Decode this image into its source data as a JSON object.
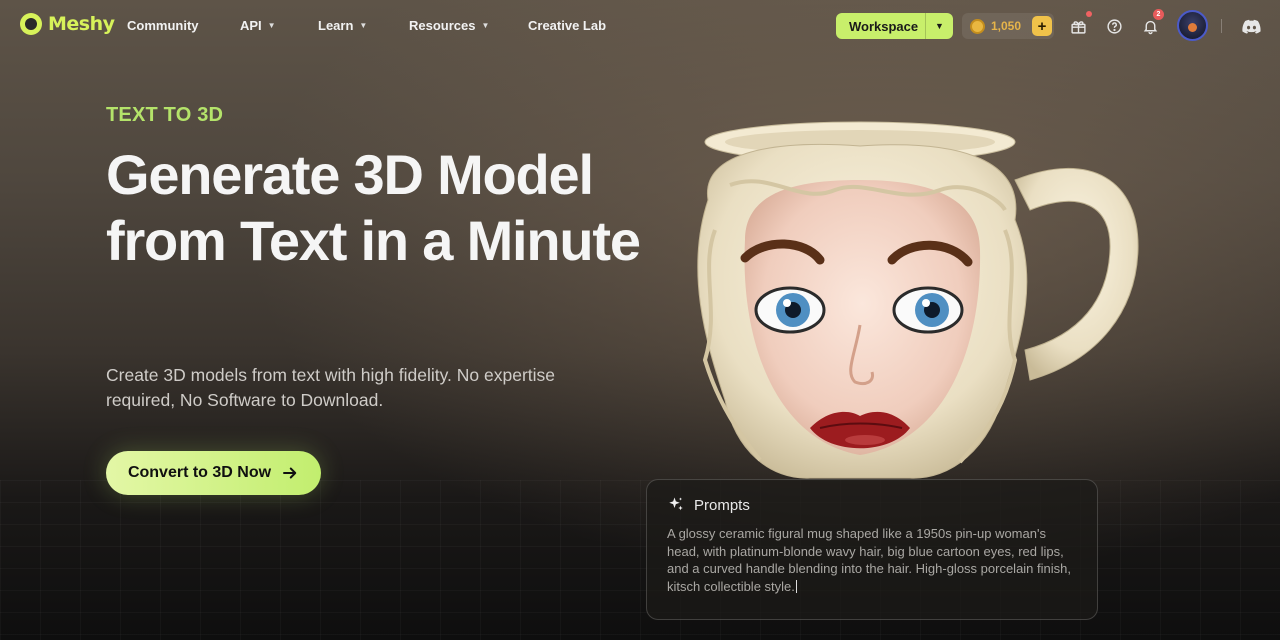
{
  "brand": {
    "name": "Meshy"
  },
  "nav": {
    "links": [
      {
        "label": "Community",
        "has_dropdown": false
      },
      {
        "label": "API",
        "has_dropdown": true
      },
      {
        "label": "Learn",
        "has_dropdown": true
      },
      {
        "label": "Resources",
        "has_dropdown": true
      },
      {
        "label": "Creative Lab",
        "has_dropdown": false
      }
    ],
    "workspace_label": "Workspace",
    "credits": "1,050",
    "notification_count": "2",
    "icons": [
      "gift-icon",
      "help-icon",
      "bell-icon",
      "discord-icon"
    ]
  },
  "hero": {
    "eyebrow": "TEXT TO 3D",
    "headline": "Generate 3D Model from Text in a Minute",
    "subtitle": "Create 3D models from text with high fidelity. No expertise required, No Software to Download.",
    "cta_label": "Convert to 3D Now"
  },
  "prompt": {
    "title": "Prompts",
    "text": "A glossy ceramic figural mug shaped like a 1950s pin-up woman's head, with platinum-blonde wavy hair, big blue cartoon eyes, red lips, and a curved handle blending into the hair. High-gloss porcelain finish, kitsch collectible style."
  },
  "colors": {
    "accent": "#c8ef6b",
    "eyebrow": "#b4e36a",
    "credits": "#e6b44a"
  }
}
